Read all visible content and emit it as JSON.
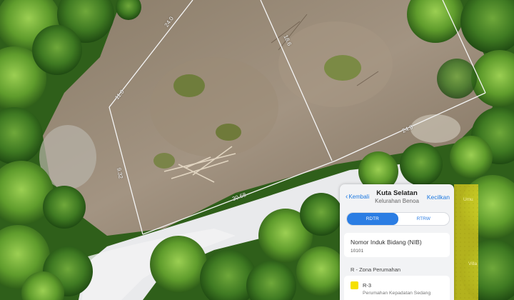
{
  "map": {
    "dimension_labels": [
      "24.0",
      "18.6",
      "11.0",
      "24.8",
      "9.32",
      "30.68"
    ]
  },
  "panel": {
    "back_label": "Kembali",
    "title": "Kuta Selatan",
    "subtitle": "Kelurahan Benoa",
    "collapse_label": "Kecilkan",
    "segments": [
      "RDTR",
      "RTRW"
    ],
    "active_segment": "RDTR",
    "nib_label": "Nomor Induk Bidang (NIB)",
    "nib_value": "10101",
    "zone_section_label": "R - Zona Perumahan",
    "zone_code": "R-3",
    "zone_description": "Perumahan Kepadatan Sedang",
    "zone_color": "#f5e000"
  },
  "overlay": {
    "labels": [
      "Umu",
      "Villa"
    ]
  }
}
